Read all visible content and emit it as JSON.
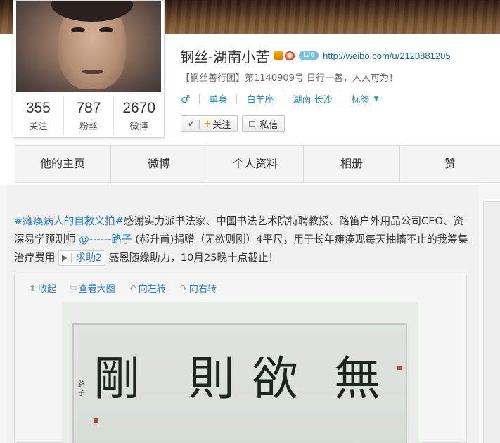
{
  "profile": {
    "name": "钢丝-湖南小苦",
    "badges": [
      "crown-icon",
      "heart-icon"
    ],
    "level_badge": "LV6",
    "url": "http://weibo.com/u/2120881205",
    "intro": "【钢丝善行团】第1140909号 日行一善，人人可为！",
    "gender_icon": "♂",
    "tags": [
      "单身",
      "白羊座",
      "湖南 长沙",
      "标签"
    ],
    "counts": [
      {
        "value": "355",
        "label": "关注"
      },
      {
        "value": "787",
        "label": "粉丝"
      },
      {
        "value": "2670",
        "label": "微博"
      }
    ],
    "follow_button": "关注",
    "message_button": "私信"
  },
  "nav": {
    "tabs": [
      "他的主页",
      "微博",
      "个人资料",
      "相册",
      "赞"
    ]
  },
  "post": {
    "topic": "#瘫痪病人的自救义拍#",
    "text_part1": "感谢实力派书法家、中国书法艺术院特聘教授、路笛户外用品公司CEO、资深易学预测师",
    "mention": "@------路子",
    "text_part2": "(郝升甫)捐赠（无欲则刚）4平尺，用于长年瘫痪现每天抽搐不止的我筹集治疗费用",
    "ask_label": "求助2",
    "text_part3": "感恩随缘助力，10月25晚十点截止！",
    "media_actions": [
      "收起",
      "查看大图",
      "向左转",
      "向右转"
    ],
    "calligraphy": [
      "剛",
      "則",
      "欲",
      "無"
    ]
  },
  "colors": {
    "link": "#2a7fc0",
    "accent_plus": "#f28a00"
  }
}
